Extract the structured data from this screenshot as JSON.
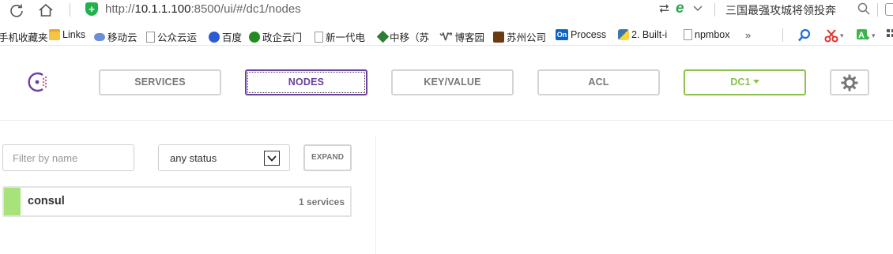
{
  "browser": {
    "url_prefix": "http://",
    "url_host": "10.1.1.100",
    "url_rest": ":8500/ui/#/dc1/nodes",
    "search_text": "三国最强攻城将领投奔",
    "bookmarks": [
      {
        "label": "手机收藏夹",
        "icon": "none"
      },
      {
        "label": "Links",
        "icon": "folder-icon"
      },
      {
        "label": "移动云",
        "icon": "cloud-icon"
      },
      {
        "label": "公众云运",
        "icon": "page-icon"
      },
      {
        "label": "百度",
        "icon": "baidu-paw-icon"
      },
      {
        "label": "政企云门",
        "icon": "gov-icon"
      },
      {
        "label": "新一代电",
        "icon": "page-icon"
      },
      {
        "label": "中移（苏",
        "icon": "china-mobile-icon"
      },
      {
        "label": "博客园",
        "icon": "cnblogs-icon"
      },
      {
        "label": "苏州公司",
        "icon": "suzhou-icon"
      },
      {
        "label": "Process",
        "icon": "processon-icon"
      },
      {
        "label": "2. Built-i",
        "icon": "python-icon"
      },
      {
        "label": "npmbox",
        "icon": "page-icon"
      }
    ],
    "more_label": "»",
    "processon_badge": "On"
  },
  "nav": {
    "services": "SERVICES",
    "nodes": "NODES",
    "keyvalue": "KEY/VALUE",
    "acl": "ACL",
    "datacenter": "DC1",
    "active_tab": "NODES"
  },
  "filters": {
    "name_placeholder": "Filter by name",
    "status_value": "any status",
    "expand_label": "EXPAND"
  },
  "nodes": [
    {
      "name": "consul",
      "services": "1 services",
      "status": "passing",
      "status_color": "#a7e27a"
    }
  ],
  "colors": {
    "accent_purple": "#6a3fa0",
    "accent_green": "#8cc14c",
    "border_gray": "#d4d4d4"
  }
}
